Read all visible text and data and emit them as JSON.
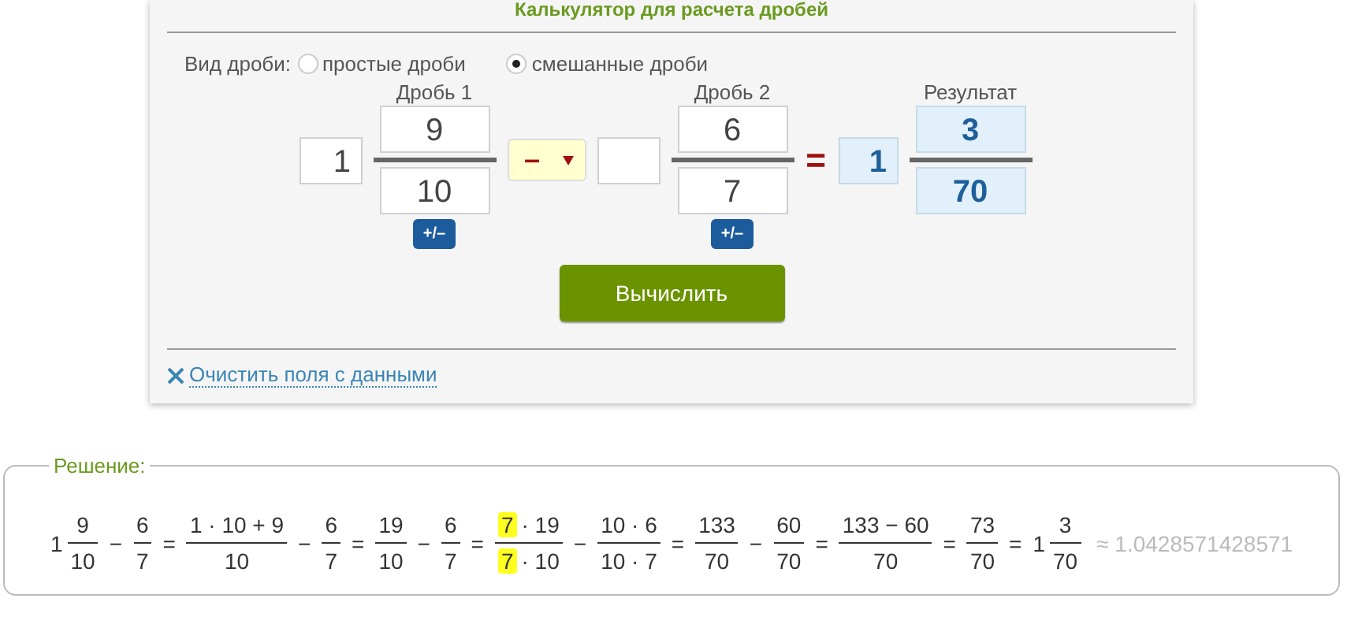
{
  "calculator": {
    "title": "Калькулятор для расчета дробей",
    "fraction_type": {
      "label": "Вид дроби:",
      "options": [
        {
          "label": "простые дроби",
          "selected": false
        },
        {
          "label": "смешанные дроби",
          "selected": true
        }
      ]
    },
    "fraction_1": {
      "label": "Дробь 1",
      "whole": "1",
      "numerator": "9",
      "denominator": "10",
      "sign_button": "+/–"
    },
    "operator": {
      "symbol": "–"
    },
    "fraction_2": {
      "label": "Дробь 2",
      "numerator": "6",
      "denominator": "7",
      "sign_button": "+/–"
    },
    "equals": "=",
    "result": {
      "label": "Результат",
      "whole": "1",
      "numerator": "3",
      "denominator": "70"
    },
    "calculate_button": "Вычислить",
    "clear_link": "Очистить поля с данными"
  },
  "solution": {
    "legend": "Решение:",
    "terms": [
      {
        "kind": "mixed",
        "whole": "1",
        "numerator": [
          {
            "text": "9",
            "highlight": false
          }
        ],
        "denominator": [
          {
            "text": "10",
            "highlight": false
          }
        ]
      },
      {
        "kind": "op",
        "text": "−"
      },
      {
        "kind": "fraction",
        "numerator": [
          {
            "text": "6",
            "highlight": false
          }
        ],
        "denominator": [
          {
            "text": "7",
            "highlight": false
          }
        ]
      },
      {
        "kind": "op",
        "text": "="
      },
      {
        "kind": "fraction",
        "numerator": [
          {
            "text": "1 · 10 + 9",
            "highlight": false
          }
        ],
        "denominator": [
          {
            "text": "10",
            "highlight": false
          }
        ]
      },
      {
        "kind": "op",
        "text": "−"
      },
      {
        "kind": "fraction",
        "numerator": [
          {
            "text": "6",
            "highlight": false
          }
        ],
        "denominator": [
          {
            "text": "7",
            "highlight": false
          }
        ]
      },
      {
        "kind": "op",
        "text": "="
      },
      {
        "kind": "fraction",
        "numerator": [
          {
            "text": "19",
            "highlight": false
          }
        ],
        "denominator": [
          {
            "text": "10",
            "highlight": false
          }
        ]
      },
      {
        "kind": "op",
        "text": "−"
      },
      {
        "kind": "fraction",
        "numerator": [
          {
            "text": "6",
            "highlight": false
          }
        ],
        "denominator": [
          {
            "text": "7",
            "highlight": false
          }
        ]
      },
      {
        "kind": "op",
        "text": "="
      },
      {
        "kind": "fraction",
        "numerator": [
          {
            "text": "7",
            "highlight": true
          },
          {
            "text": "· 19",
            "highlight": false
          }
        ],
        "denominator": [
          {
            "text": "7",
            "highlight": true
          },
          {
            "text": "· 10",
            "highlight": false
          }
        ]
      },
      {
        "kind": "op",
        "text": "−"
      },
      {
        "kind": "fraction",
        "numerator": [
          {
            "text": "10 · 6",
            "highlight": false
          }
        ],
        "denominator": [
          {
            "text": "10 · 7",
            "highlight": false
          }
        ]
      },
      {
        "kind": "op",
        "text": "="
      },
      {
        "kind": "fraction",
        "numerator": [
          {
            "text": "133",
            "highlight": false
          }
        ],
        "denominator": [
          {
            "text": "70",
            "highlight": false
          }
        ]
      },
      {
        "kind": "op",
        "text": "−"
      },
      {
        "kind": "fraction",
        "numerator": [
          {
            "text": "60",
            "highlight": false
          }
        ],
        "denominator": [
          {
            "text": "70",
            "highlight": false
          }
        ]
      },
      {
        "kind": "op",
        "text": "="
      },
      {
        "kind": "fraction",
        "numerator": [
          {
            "text": "133 − 60",
            "highlight": false
          }
        ],
        "denominator": [
          {
            "text": "70",
            "highlight": false
          }
        ]
      },
      {
        "kind": "op",
        "text": "="
      },
      {
        "kind": "fraction",
        "numerator": [
          {
            "text": "73",
            "highlight": false
          }
        ],
        "denominator": [
          {
            "text": "70",
            "highlight": false
          }
        ]
      },
      {
        "kind": "op",
        "text": "="
      },
      {
        "kind": "mixed",
        "whole": "1",
        "numerator": [
          {
            "text": "3",
            "highlight": false
          }
        ],
        "denominator": [
          {
            "text": "70",
            "highlight": false
          }
        ]
      },
      {
        "kind": "approx",
        "text": "≈ 1.0428571428571"
      }
    ]
  }
}
